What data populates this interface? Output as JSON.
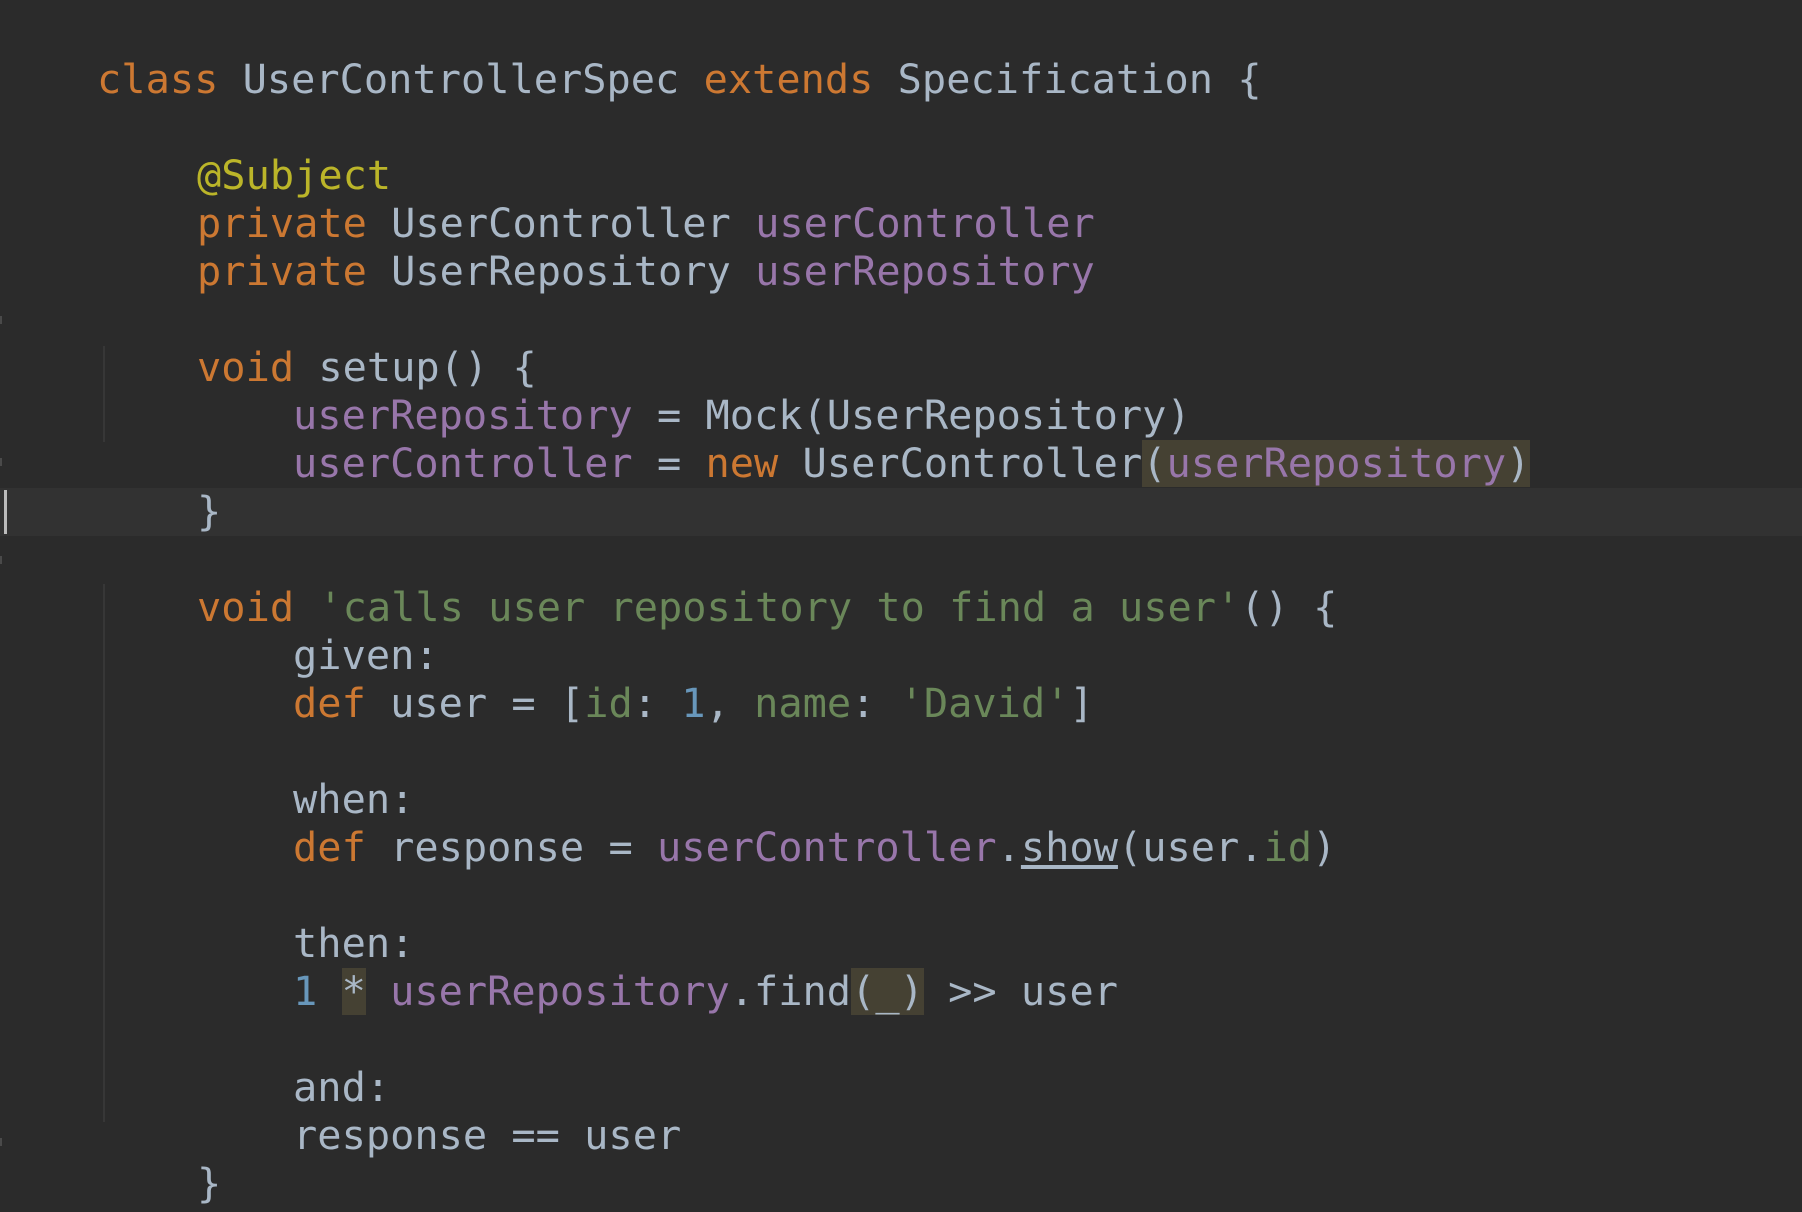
{
  "code": {
    "l1": {
      "t1": "class",
      "t2": " UserControllerSpec ",
      "t3": "extends",
      "t4": " Specification {"
    },
    "l3": {
      "t1": "@Subject"
    },
    "l4": {
      "t1": "private",
      "t2": " UserController ",
      "t3": "userController"
    },
    "l5": {
      "t1": "private",
      "t2": " UserRepository ",
      "t3": "userRepository"
    },
    "l7": {
      "t1": "void",
      "t2": " setup() {"
    },
    "l8": {
      "t1": "userRepository",
      "t2": " = Mock(UserRepository)"
    },
    "l9": {
      "t1": "userController",
      "t2": " = ",
      "t3": "new",
      "t4": " UserController",
      "t5": "(",
      "t6": "userRepository",
      "t7": ")"
    },
    "l10": {
      "t1": "}"
    },
    "l12": {
      "t1": "void",
      "t2": " ",
      "t3": "'calls user repository to find a user'",
      "t4": "() {"
    },
    "l13": {
      "t1": "given:"
    },
    "l14": {
      "t1": "def",
      "t2": " user = [",
      "t3": "id",
      "t4": ": ",
      "t5": "1",
      "t6": ", ",
      "t7": "name",
      "t8": ": ",
      "t9": "'David'",
      "t10": "]"
    },
    "l16": {
      "t1": "when:"
    },
    "l17": {
      "t1": "def",
      "t2": " response = ",
      "t3": "userController",
      "t4": ".",
      "t5": "show",
      "t6": "(user.",
      "t7": "id",
      "t8": ")"
    },
    "l19": {
      "t1": "then:"
    },
    "l20": {
      "t1": "1",
      "t2": " ",
      "t3": "*",
      "t4": " ",
      "t5": "userRepository",
      "t6": ".find",
      "t7": "(_)",
      "t8": " >> user"
    },
    "l22": {
      "t1": "and:"
    },
    "l23": {
      "t1": "response == user"
    },
    "l24": {
      "t1": "}"
    },
    "l25": {
      "t1": "}"
    }
  },
  "colors": {
    "background": "#2b2b2b",
    "keyword": "#cc7832",
    "annotation": "#bbb529",
    "field": "#9876aa",
    "string": "#6a8759",
    "number": "#6897bb",
    "default": "#a9b7c6"
  }
}
